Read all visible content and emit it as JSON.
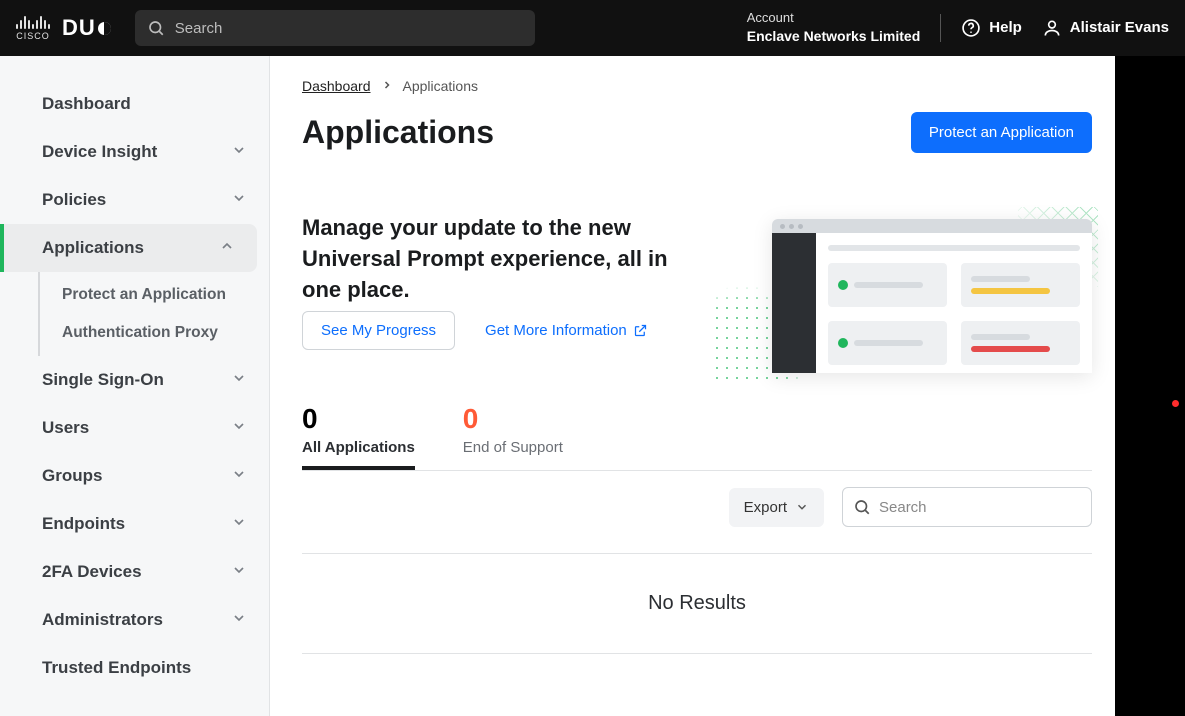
{
  "header": {
    "search_placeholder": "Search",
    "account_label": "Account",
    "account_name": "Enclave Networks Limited",
    "help_label": "Help",
    "user_name": "Alistair Evans"
  },
  "sidebar": {
    "items": [
      {
        "label": "Dashboard",
        "expandable": false
      },
      {
        "label": "Device Insight",
        "expandable": true
      },
      {
        "label": "Policies",
        "expandable": true
      },
      {
        "label": "Applications",
        "expandable": true,
        "active": true,
        "children": [
          {
            "label": "Protect an Application"
          },
          {
            "label": "Authentication Proxy"
          }
        ]
      },
      {
        "label": "Single Sign-On",
        "expandable": true
      },
      {
        "label": "Users",
        "expandable": true
      },
      {
        "label": "Groups",
        "expandable": true
      },
      {
        "label": "Endpoints",
        "expandable": true
      },
      {
        "label": "2FA Devices",
        "expandable": true
      },
      {
        "label": "Administrators",
        "expandable": true
      },
      {
        "label": "Trusted Endpoints",
        "expandable": false
      }
    ]
  },
  "breadcrumb": {
    "root": "Dashboard",
    "current": "Applications"
  },
  "page": {
    "title": "Applications",
    "protect_button": "Protect an Application",
    "promo_text": "Manage your update to the new Universal Prompt experience, all in one place.",
    "see_progress": "See My Progress",
    "more_info": "Get More Information"
  },
  "tabs": {
    "all": {
      "count": "0",
      "label": "All Applications"
    },
    "eos": {
      "count": "0",
      "label": "End of Support"
    }
  },
  "table": {
    "export_label": "Export",
    "search_placeholder": "Search",
    "no_results": "No Results"
  }
}
